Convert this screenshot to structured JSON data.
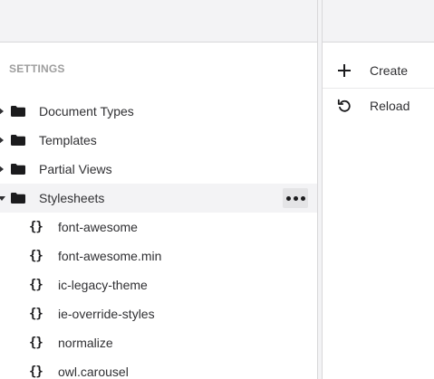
{
  "tree": {
    "section_title": "SETTINGS",
    "items": [
      {
        "label": "Document Types",
        "icon": "folder-icon",
        "expanded": false
      },
      {
        "label": "Templates",
        "icon": "folder-icon",
        "expanded": false
      },
      {
        "label": "Partial Views",
        "icon": "folder-icon",
        "expanded": false
      },
      {
        "label": "Stylesheets",
        "icon": "folder-icon",
        "expanded": true,
        "active": true
      }
    ],
    "stylesheets_children": [
      {
        "label": "font-awesome",
        "icon": "braces-icon"
      },
      {
        "label": "font-awesome.min",
        "icon": "braces-icon"
      },
      {
        "label": "ic-legacy-theme",
        "icon": "braces-icon"
      },
      {
        "label": "ie-override-styles",
        "icon": "braces-icon"
      },
      {
        "label": "normalize",
        "icon": "braces-icon"
      },
      {
        "label": "owl.carousel",
        "icon": "braces-icon"
      }
    ],
    "brace_glyph": "{}"
  },
  "actions": {
    "items": [
      {
        "label": "Create",
        "icon": "plus-icon"
      },
      {
        "label": "Reload",
        "icon": "reload-icon"
      }
    ]
  }
}
